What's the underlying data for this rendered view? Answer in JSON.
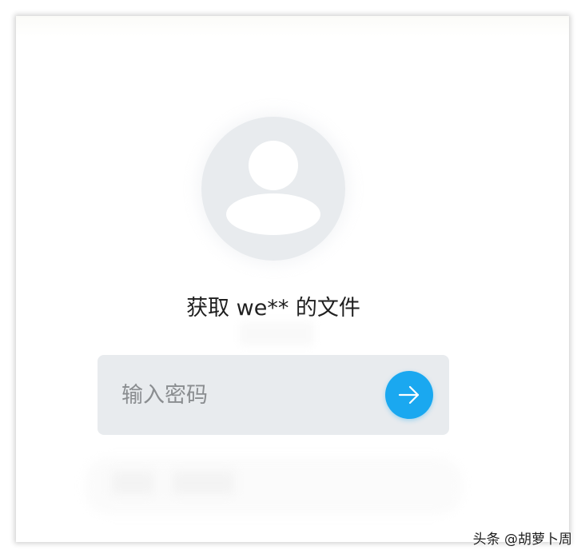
{
  "title": "获取 we** 的文件",
  "password": {
    "placeholder": "输入密码",
    "value": ""
  },
  "submit": {
    "icon": "arrow-right-icon"
  },
  "avatar": {
    "icon": "user-avatar-icon"
  },
  "watermark": "头条 @胡萝卜周",
  "colors": {
    "accent": "#1aa8f0",
    "input_bg": "#e8ebee",
    "avatar_bg": "#e8ebee",
    "text": "#1f1f1f",
    "placeholder": "#8a8d90"
  }
}
